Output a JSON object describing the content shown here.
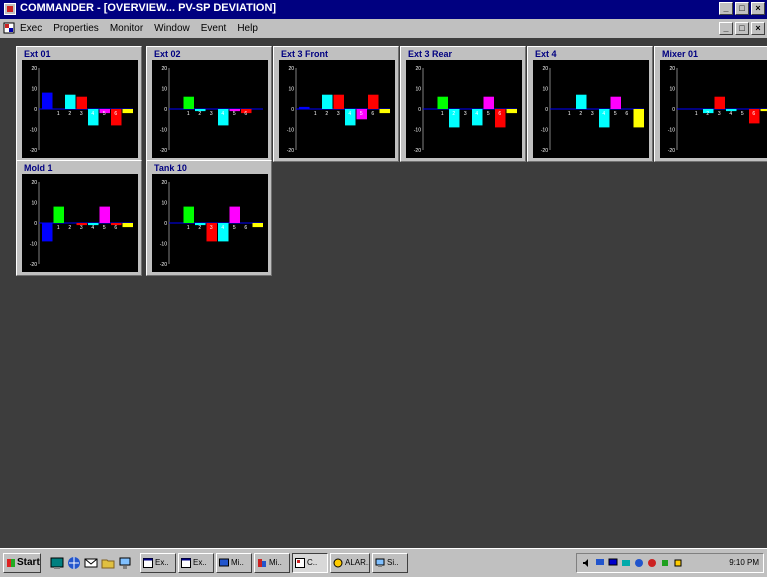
{
  "window": {
    "title": "COMMANDER - [OVERVIEW... PV-SP DEVIATION]",
    "controls": [
      "_",
      "□",
      "×"
    ]
  },
  "menubar": {
    "items": [
      "Exec",
      "Properties",
      "Monitor",
      "Window",
      "Event",
      "Help"
    ],
    "mdi_controls": [
      "_",
      "□",
      "×"
    ]
  },
  "charts": [
    {
      "title": "Ext 01",
      "values": [
        8,
        0,
        7,
        6,
        -8,
        -2,
        -8,
        -2
      ]
    },
    {
      "title": "Ext 02",
      "values": [
        0,
        6,
        -1,
        0,
        -8,
        -1,
        -2,
        0
      ]
    },
    {
      "title": "Ext 3 Front",
      "values": [
        1,
        0,
        7,
        7,
        -8,
        -5,
        7,
        -2
      ]
    },
    {
      "title": "Ext 3 Rear",
      "values": [
        0,
        6,
        -9,
        0,
        -8,
        6,
        -9,
        -2
      ]
    },
    {
      "title": "Ext 4",
      "values": [
        0,
        0,
        7,
        0,
        -9,
        6,
        0,
        -9
      ]
    },
    {
      "title": "Mixer 01",
      "values": [
        0,
        0,
        -2,
        6,
        -1,
        0,
        -7,
        -1
      ]
    },
    {
      "title": "Mold 1",
      "values": [
        -9,
        8,
        0,
        -1,
        -1,
        8,
        -1,
        -2
      ]
    },
    {
      "title": "Tank 10",
      "values": [
        0,
        8,
        -1,
        -9,
        -9,
        8,
        0,
        -2
      ]
    }
  ],
  "chart_common": {
    "ylim": [
      -20,
      20
    ],
    "y_ticks": [
      "20",
      "10",
      "0",
      "-10",
      "-20"
    ],
    "x_ticks": [
      "1",
      "2",
      "3",
      "4",
      "5",
      "6"
    ],
    "series_colors": [
      "#0000ff",
      "#00ff00",
      "#00ffff",
      "#ff0000",
      "#00ffff",
      "#ff00ff",
      "#ff0000",
      "#ffff00"
    ]
  },
  "taskbar": {
    "start_label": "Start",
    "buttons": [
      "Ex..",
      "Ex..",
      "Mi..",
      "Mi..",
      "C..",
      "ALAR..",
      "Si.."
    ],
    "active_index": 4,
    "clock": "9:10 PM"
  },
  "colors": {
    "title_bar": "#000080",
    "workspace": "#3d3d3d",
    "panel": "#c0c0c0",
    "chart_bg": "#000000"
  }
}
